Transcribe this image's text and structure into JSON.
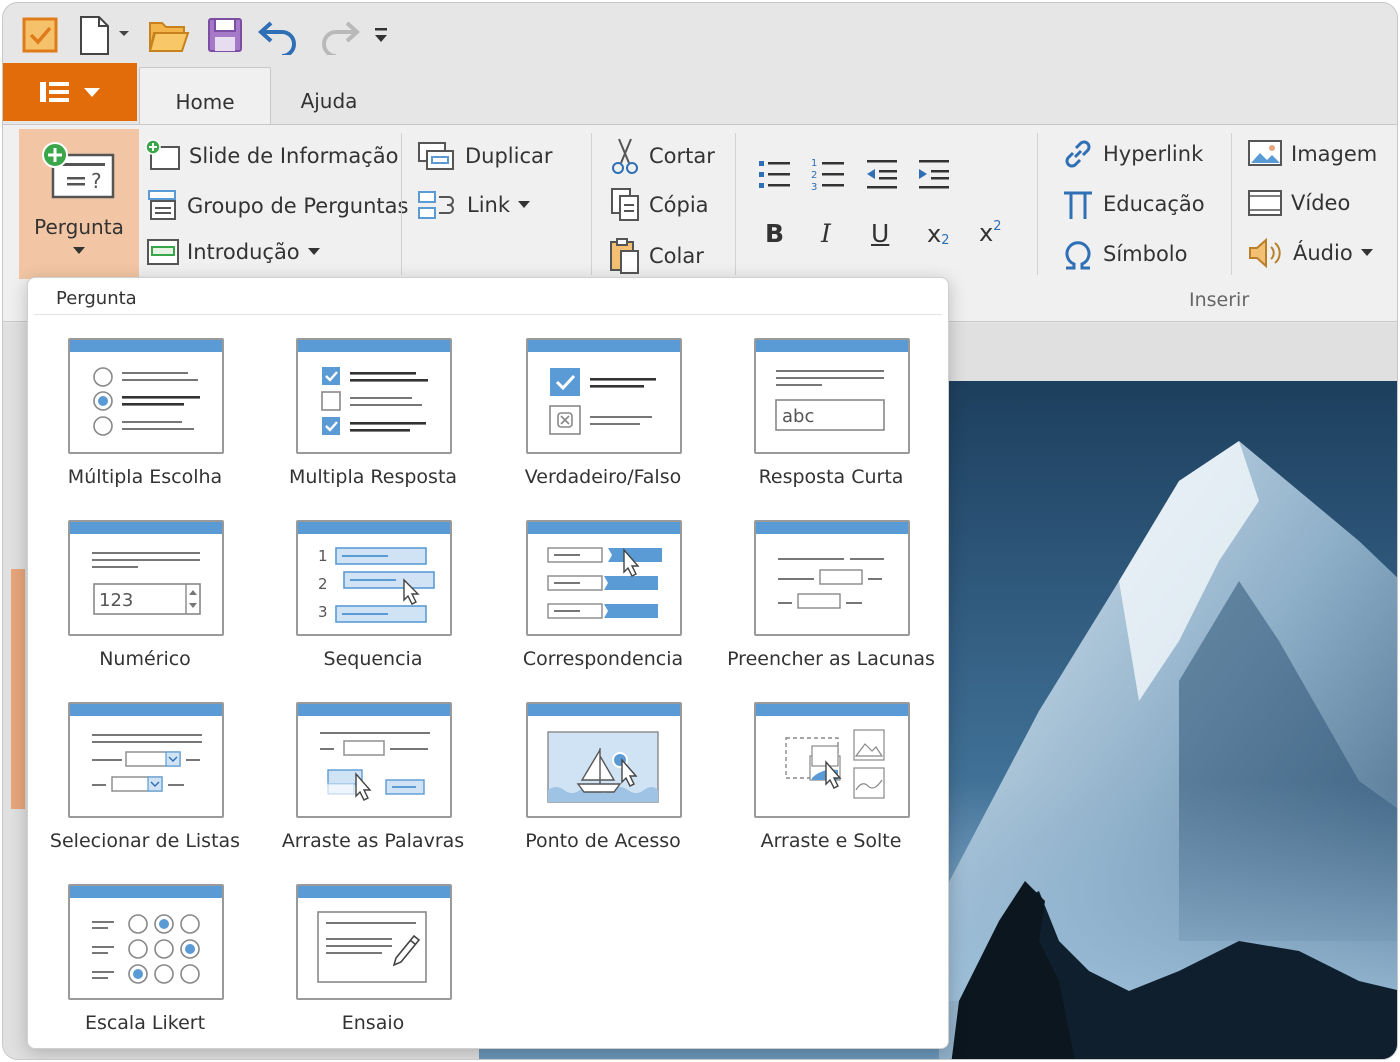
{
  "tabs": {
    "home": "Home",
    "ajuda": "Ajuda"
  },
  "ribbon": {
    "pergunta": "Pergunta",
    "slide_info": "Slide de Informação",
    "grupo_perguntas": "Groupo de Perguntas",
    "introducao": "Introdução",
    "duplicar": "Duplicar",
    "link": "Link",
    "cortar": "Cortar",
    "copia": "Cópia",
    "colar": "Colar",
    "bold": "B",
    "italic": "I",
    "underline": "U",
    "subscript": "x",
    "superscript": "x",
    "sub_2": "2",
    "sup_2": "2",
    "hyperlink": "Hyperlink",
    "educacao": "Educação",
    "simbolo": "Símbolo",
    "imagem": "Imagem",
    "video": "Vídeo",
    "audio": "Áudio",
    "inserir_label": "Inserir"
  },
  "dropdown": {
    "title": "Pergunta",
    "items": [
      {
        "label": "Múltipla Escolha",
        "icon": "multiple-choice-icon"
      },
      {
        "label": "Multipla Resposta",
        "icon": "multiple-response-icon"
      },
      {
        "label": "Verdadeiro/Falso",
        "icon": "true-false-icon"
      },
      {
        "label": "Resposta Curta",
        "icon": "short-answer-icon"
      },
      {
        "label": "Numérico",
        "icon": "numeric-icon"
      },
      {
        "label": "Sequencia",
        "icon": "sequence-icon"
      },
      {
        "label": "Correspondencia",
        "icon": "matching-icon"
      },
      {
        "label": "Preencher as Lacunas",
        "icon": "fill-blanks-icon"
      },
      {
        "label": "Selecionar de Listas",
        "icon": "select-from-lists-icon"
      },
      {
        "label": "Arraste as Palavras",
        "icon": "drag-words-icon"
      },
      {
        "label": "Ponto de Acesso",
        "icon": "hotspot-icon"
      },
      {
        "label": "Arraste e Solte",
        "icon": "drag-drop-icon"
      },
      {
        "label": "Escala Likert",
        "icon": "likert-scale-icon"
      },
      {
        "label": "Ensaio",
        "icon": "essay-icon"
      }
    ],
    "icon_texts": {
      "abc": "abc",
      "num": "123",
      "seq1": "1",
      "seq2": "2",
      "seq3": "3"
    }
  },
  "colors": {
    "accent": "#e36c0a",
    "blue": "#5b9bd5",
    "selected": "#f2c6a4"
  }
}
